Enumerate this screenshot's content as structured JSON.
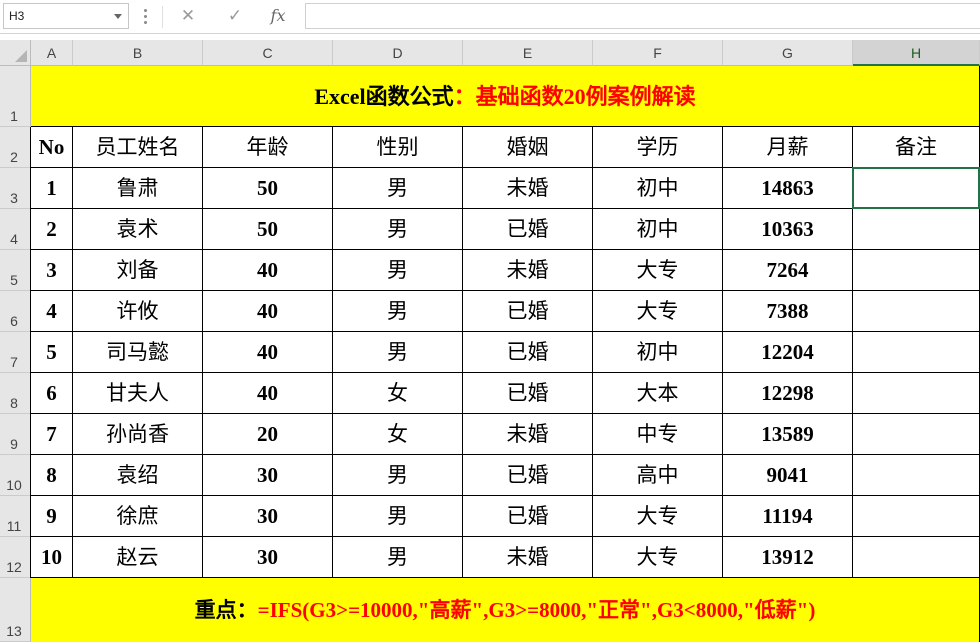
{
  "name_box": {
    "value": "H3"
  },
  "formula_bar": {
    "cancel_glyph": "✕",
    "enter_glyph": "✓",
    "fx_label": "fx",
    "value": ""
  },
  "columns": [
    "A",
    "B",
    "C",
    "D",
    "E",
    "F",
    "G",
    "H"
  ],
  "rows": [
    "1",
    "2",
    "3",
    "4",
    "5",
    "6",
    "7",
    "8",
    "9",
    "10",
    "11",
    "12",
    "13"
  ],
  "title": {
    "prefix": "Excel函数公式",
    "suffix": "：基础函数20例案例解读"
  },
  "headers": [
    "No",
    "员工姓名",
    "年龄",
    "性别",
    "婚姻",
    "学历",
    "月薪",
    "备注"
  ],
  "table": [
    [
      "1",
      "鲁肃",
      "50",
      "男",
      "未婚",
      "初中",
      "14863",
      ""
    ],
    [
      "2",
      "袁术",
      "50",
      "男",
      "已婚",
      "初中",
      "10363",
      ""
    ],
    [
      "3",
      "刘备",
      "40",
      "男",
      "未婚",
      "大专",
      "7264",
      ""
    ],
    [
      "4",
      "许攸",
      "40",
      "男",
      "已婚",
      "大专",
      "7388",
      ""
    ],
    [
      "5",
      "司马懿",
      "40",
      "男",
      "已婚",
      "初中",
      "12204",
      ""
    ],
    [
      "6",
      "甘夫人",
      "40",
      "女",
      "已婚",
      "大本",
      "12298",
      ""
    ],
    [
      "7",
      "孙尚香",
      "20",
      "女",
      "未婚",
      "中专",
      "13589",
      ""
    ],
    [
      "8",
      "袁绍",
      "30",
      "男",
      "已婚",
      "高中",
      "9041",
      ""
    ],
    [
      "9",
      "徐庶",
      "30",
      "男",
      "已婚",
      "大专",
      "11194",
      ""
    ],
    [
      "10",
      "赵云",
      "30",
      "男",
      "未婚",
      "大专",
      "13912",
      ""
    ]
  ],
  "footer": {
    "prefix": "重点：",
    "formula": "=IFS(G3>=10000,\"高薪\",G3>=8000,\"正常\",G3<8000,\"低薪\")"
  },
  "colors": {
    "banner": "#ffff00",
    "accent_red": "#ff0000",
    "selection": "#217346"
  }
}
